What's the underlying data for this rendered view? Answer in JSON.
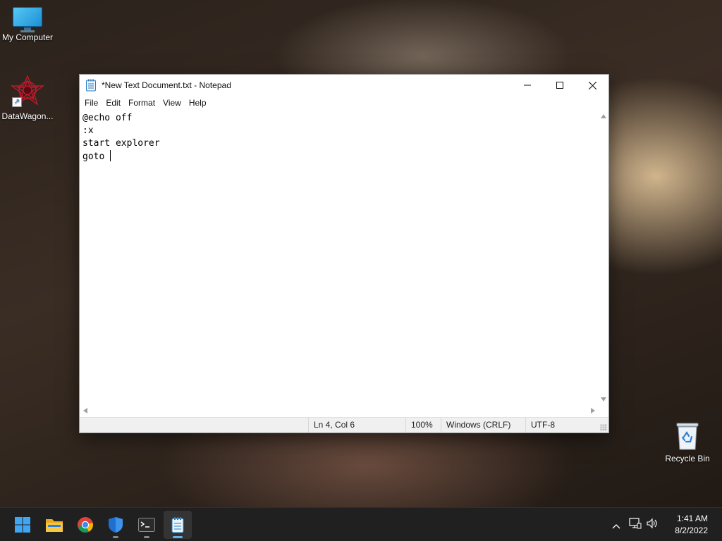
{
  "desktop": {
    "icons": [
      {
        "label": "My Computer",
        "icon": "monitor-icon"
      },
      {
        "label": "DataWagon...",
        "icon": "app-star-icon"
      },
      {
        "label": "Recycle Bin",
        "icon": "recycle-bin-icon"
      }
    ]
  },
  "notepad": {
    "title": "*New Text Document.txt - Notepad",
    "menu": [
      "File",
      "Edit",
      "Format",
      "View",
      "Help"
    ],
    "content_lines": [
      "@echo off",
      ":x",
      "start explorer",
      "goto "
    ],
    "status": {
      "position": "Ln 4, Col 6",
      "zoom": "100%",
      "line_ending": "Windows (CRLF)",
      "encoding": "UTF-8"
    }
  },
  "taskbar": {
    "apps": [
      "start-button",
      "file-explorer",
      "chrome",
      "windows-security",
      "terminal",
      "notepad"
    ],
    "clock": {
      "time": "1:41 AM",
      "date": "8/2/2022"
    }
  },
  "colors": {
    "accent": "#5fb2f2",
    "taskbar": "#202020",
    "window_bg": "#ffffff"
  }
}
